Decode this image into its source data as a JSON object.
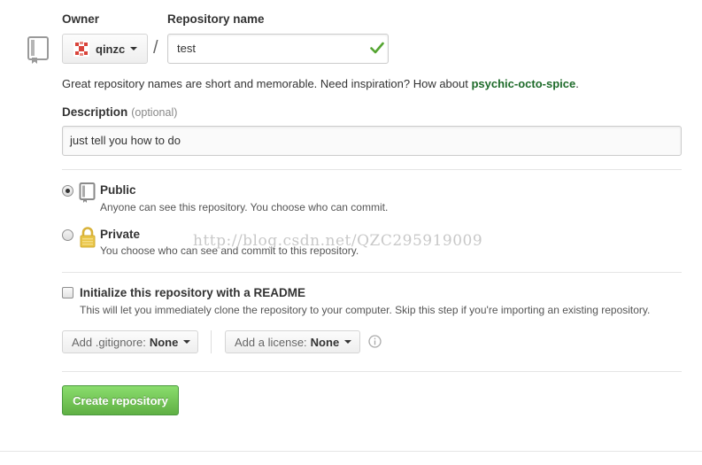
{
  "owner": {
    "label": "Owner",
    "username": "qinzc"
  },
  "repository": {
    "label": "Repository name",
    "separator": "/",
    "value": "test"
  },
  "hint": {
    "prefix": "Great repository names are short and memorable. Need inspiration? How about ",
    "suggestion": "psychic-octo-spice",
    "suffix": "."
  },
  "description": {
    "label": "Description",
    "optional": "(optional)",
    "value": "just tell you how to do"
  },
  "visibility": {
    "public": {
      "title": "Public",
      "desc": "Anyone can see this repository. You choose who can commit.",
      "selected": true
    },
    "private": {
      "title": "Private",
      "desc": "You choose who can see and commit to this repository.",
      "selected": false
    }
  },
  "watermark": "http://blog.csdn.net/QZC295919009",
  "init": {
    "title": "Initialize this repository with a README",
    "desc": "This will let you immediately clone the repository to your computer. Skip this step if you're importing an existing repository.",
    "checked": false
  },
  "gitignore": {
    "prefix": "Add .gitignore:",
    "value": "None"
  },
  "license": {
    "prefix": "Add a license:",
    "value": "None"
  },
  "create_button": "Create repository",
  "colors": {
    "accent_green": "#60b044",
    "suggestion_green": "#1e6b2a",
    "check_green": "#55a532",
    "lock_gold": "#e8c547"
  },
  "icons": [
    "repo-icon",
    "check-icon",
    "public-repo-icon",
    "lock-icon",
    "info-icon",
    "chevron-down-icon"
  ]
}
